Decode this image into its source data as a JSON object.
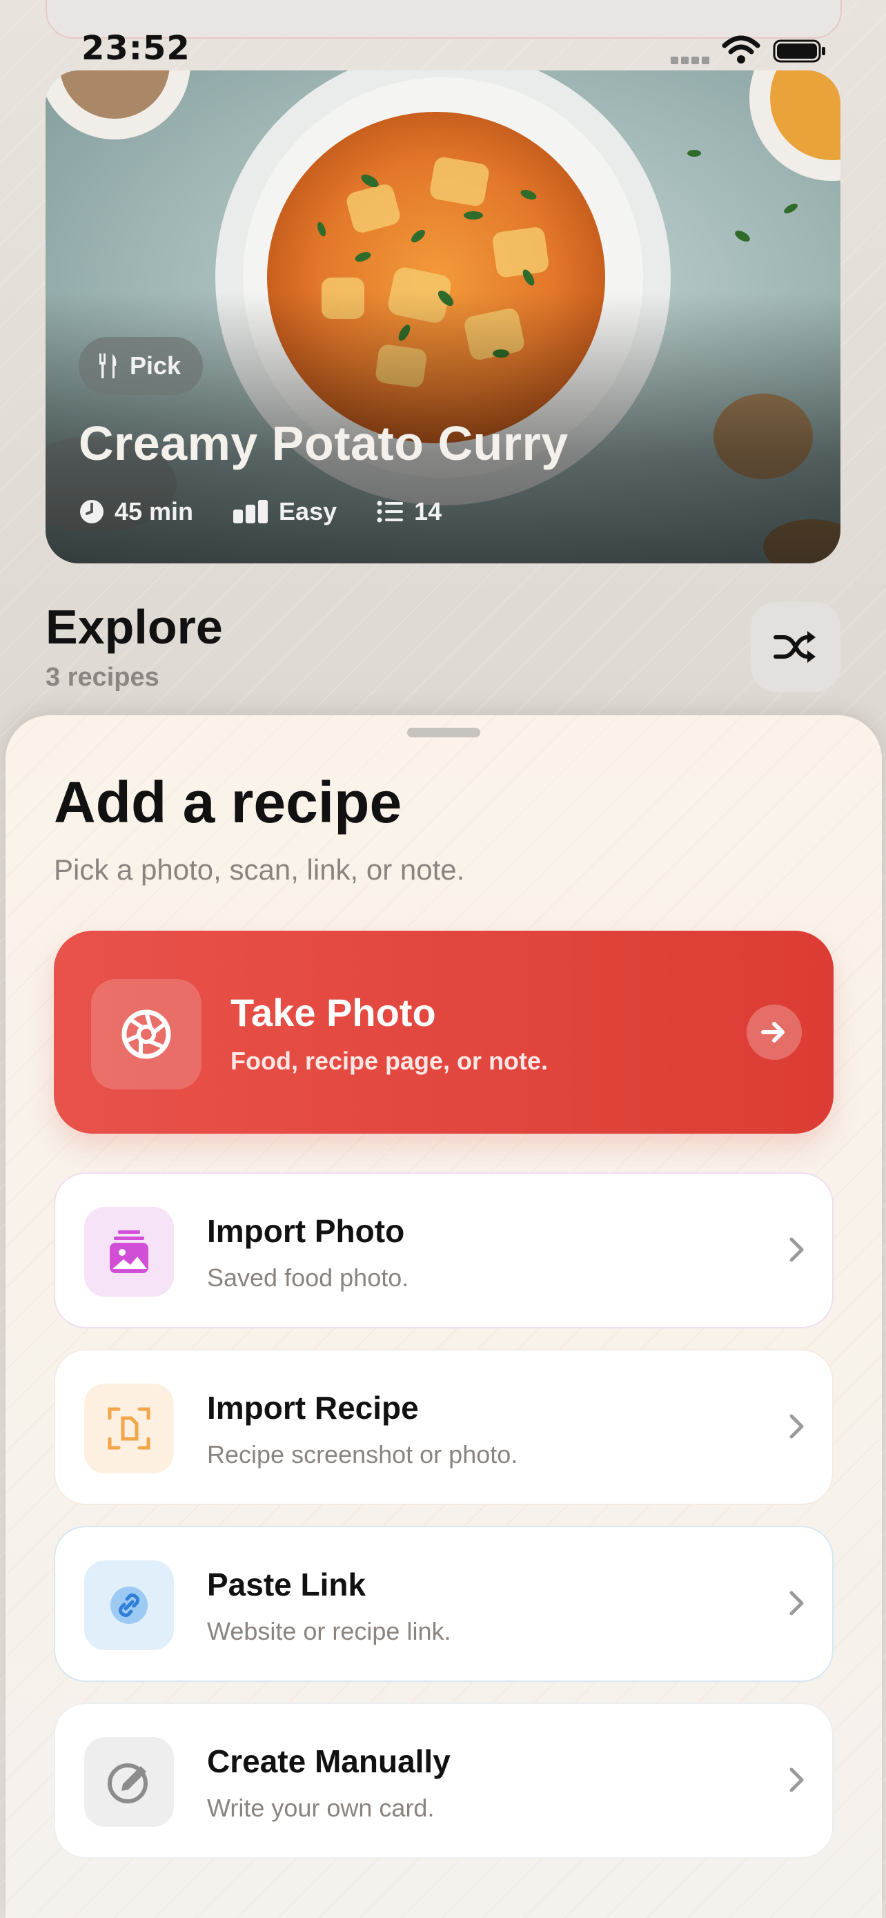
{
  "status_bar": {
    "time": "23:52"
  },
  "hero": {
    "badge": "Pick",
    "title": "Creamy Potato Curry",
    "time": "45 min",
    "difficulty": "Easy",
    "ingredients_count": "14"
  },
  "explore": {
    "title": "Explore",
    "count": "3 recipes"
  },
  "sheet": {
    "title": "Add a recipe",
    "subtitle": "Pick a photo, scan, link, or note.",
    "primary": {
      "title": "Take Photo",
      "subtitle": "Food, recipe page, or note."
    },
    "options": [
      {
        "title": "Import Photo",
        "subtitle": "Saved food photo.",
        "color": "#d14fd6",
        "tint": "#f7e3f7",
        "border": "#f1dcf1"
      },
      {
        "title": "Import Recipe",
        "subtitle": "Recipe screenshot or photo.",
        "color": "#f2a64a",
        "tint": "#fdf0e0",
        "border": "#f6ebe0"
      },
      {
        "title": "Paste Link",
        "subtitle": "Website or recipe link.",
        "color": "#3c8de0",
        "tint": "#e1effb",
        "border": "#d6e7f4"
      },
      {
        "title": "Create Manually",
        "subtitle": "Write your own card.",
        "color": "#8c8c8c",
        "tint": "#eeeeee",
        "border": "#eeeeee"
      }
    ]
  },
  "colors": {
    "accent": "#e0443c",
    "text": "#111111",
    "muted": "#8a8480"
  }
}
